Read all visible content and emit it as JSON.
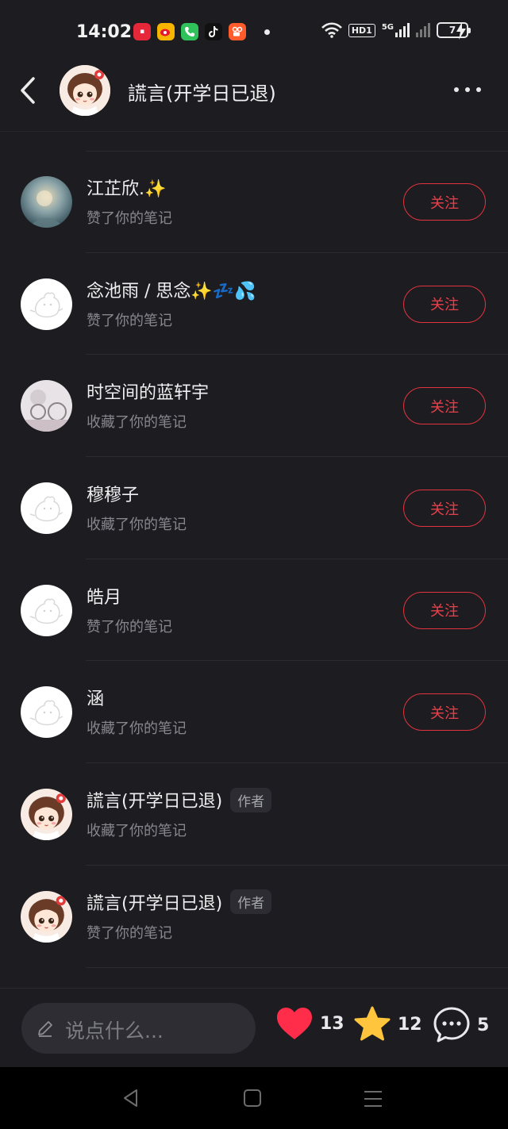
{
  "status_bar": {
    "time": "14:02",
    "network": "HD1",
    "signal_label": "5G",
    "battery": "7"
  },
  "header": {
    "title": "謊言(开学日已退)",
    "back_icon": "chevron-left-icon",
    "more_icon": "more-horizontal-icon"
  },
  "rows": [
    {
      "name": "江芷欣.✨",
      "action": "赞了你的笔记",
      "follow": "关注",
      "avatar": "photo-blue"
    },
    {
      "name": "念池雨 / 思念✨💤💦",
      "action": "赞了你的笔记",
      "follow": "关注",
      "avatar": "default"
    },
    {
      "name": "时空间的蓝轩宇",
      "action": "收藏了你的笔记",
      "follow": "关注",
      "avatar": "photo-grey"
    },
    {
      "name": "穆穆子",
      "action": "收藏了你的笔记",
      "follow": "关注",
      "avatar": "default"
    },
    {
      "name": "皓月",
      "action": "赞了你的笔记",
      "follow": "关注",
      "avatar": "default"
    },
    {
      "name": "涵",
      "action": "收藏了你的笔记",
      "follow": "关注",
      "avatar": "default"
    },
    {
      "name": "謊言(开学日已退)",
      "action": "收藏了你的笔记",
      "tag": "作者",
      "avatar": "anime"
    },
    {
      "name": "謊言(开学日已退)",
      "action": "赞了你的笔记",
      "tag": "作者",
      "avatar": "anime"
    }
  ],
  "bottom_bar": {
    "comment_placeholder": "说点什么...",
    "likes": "13",
    "collects": "12",
    "comments": "5"
  },
  "colors": {
    "background": "#1d1d21",
    "accent_red": "#e8404b",
    "like_red": "#ff2d4a",
    "collect_yellow": "#ffc53d"
  }
}
